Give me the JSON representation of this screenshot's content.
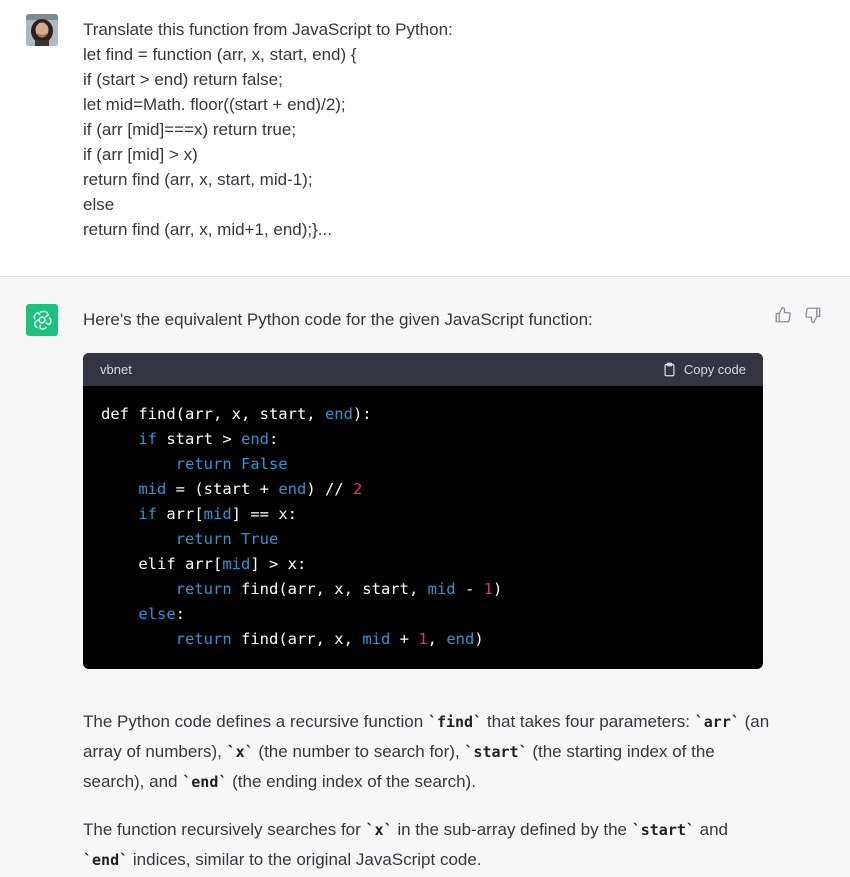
{
  "user": {
    "message_lines": [
      "Translate this function from JavaScript to Python:",
      "let find = function (arr, x, start, end) {",
      "if (start > end) return false;",
      "let mid=Math. floor((start + end)/2);",
      "if (arr [mid]===x) return true;",
      "if (arr [mid] > x)",
      "return find (arr, x, start, mid-1);",
      "else",
      "return find (arr, x, mid+1, end);}..."
    ]
  },
  "assistant": {
    "intro": "Here's the equivalent Python code for the given JavaScript function:",
    "code_block": {
      "language": "vbnet",
      "copy_label": "Copy code",
      "lines": [
        {
          "indent": "",
          "tokens": [
            {
              "t": "def find(arr, x, start, ",
              "c": "plain"
            },
            {
              "t": "end",
              "c": "kw"
            },
            {
              "t": "):",
              "c": "plain"
            }
          ]
        },
        {
          "indent": "    ",
          "tokens": [
            {
              "t": "if",
              "c": "kw"
            },
            {
              "t": " start > ",
              "c": "plain"
            },
            {
              "t": "end",
              "c": "kw"
            },
            {
              "t": ":",
              "c": "plain"
            }
          ]
        },
        {
          "indent": "        ",
          "tokens": [
            {
              "t": "return False",
              "c": "kw"
            }
          ]
        },
        {
          "indent": "    ",
          "tokens": [
            {
              "t": "mid",
              "c": "kw"
            },
            {
              "t": " = (start + ",
              "c": "plain"
            },
            {
              "t": "end",
              "c": "kw"
            },
            {
              "t": ") // ",
              "c": "plain"
            },
            {
              "t": "2",
              "c": "num"
            }
          ]
        },
        {
          "indent": "    ",
          "tokens": [
            {
              "t": "if",
              "c": "kw"
            },
            {
              "t": " arr[",
              "c": "plain"
            },
            {
              "t": "mid",
              "c": "kw"
            },
            {
              "t": "] == x:",
              "c": "plain"
            }
          ]
        },
        {
          "indent": "        ",
          "tokens": [
            {
              "t": "return True",
              "c": "kw"
            }
          ]
        },
        {
          "indent": "    ",
          "tokens": [
            {
              "t": "elif arr[",
              "c": "plain"
            },
            {
              "t": "mid",
              "c": "kw"
            },
            {
              "t": "] > x:",
              "c": "plain"
            }
          ]
        },
        {
          "indent": "        ",
          "tokens": [
            {
              "t": "return",
              "c": "kw"
            },
            {
              "t": " find(arr, x, start, ",
              "c": "plain"
            },
            {
              "t": "mid",
              "c": "kw"
            },
            {
              "t": " - ",
              "c": "plain"
            },
            {
              "t": "1",
              "c": "num"
            },
            {
              "t": ")",
              "c": "plain"
            }
          ]
        },
        {
          "indent": "    ",
          "tokens": [
            {
              "t": "else",
              "c": "kw"
            },
            {
              "t": ":",
              "c": "plain"
            }
          ]
        },
        {
          "indent": "        ",
          "tokens": [
            {
              "t": "return",
              "c": "kw"
            },
            {
              "t": " find(arr, x, ",
              "c": "plain"
            },
            {
              "t": "mid",
              "c": "kw"
            },
            {
              "t": " + ",
              "c": "plain"
            },
            {
              "t": "1",
              "c": "num"
            },
            {
              "t": ", ",
              "c": "plain"
            },
            {
              "t": "end",
              "c": "kw"
            },
            {
              "t": ")",
              "c": "plain"
            }
          ]
        }
      ]
    },
    "paragraph1": [
      {
        "t": "The Python code defines a recursive function ",
        "code": false
      },
      {
        "t": "`find`",
        "code": true
      },
      {
        "t": " that takes four parameters: ",
        "code": false
      },
      {
        "t": "`arr`",
        "code": true
      },
      {
        "t": " (an array of numbers), ",
        "code": false
      },
      {
        "t": "`x`",
        "code": true
      },
      {
        "t": " (the number to search for), ",
        "code": false
      },
      {
        "t": "`start`",
        "code": true
      },
      {
        "t": " (the starting index of the search), and ",
        "code": false
      },
      {
        "t": "`end`",
        "code": true
      },
      {
        "t": " (the ending index of the search).",
        "code": false
      }
    ],
    "paragraph2": [
      {
        "t": "The function recursively searches for ",
        "code": false
      },
      {
        "t": "`x`",
        "code": true
      },
      {
        "t": " in the sub-array defined by the ",
        "code": false
      },
      {
        "t": "`start`",
        "code": true
      },
      {
        "t": " and ",
        "code": false
      },
      {
        "t": "`end`",
        "code": true
      },
      {
        "t": " indices, similar to the original JavaScript code.",
        "code": false
      }
    ]
  },
  "icons": {
    "assistant_avatar": "openai-logo-icon",
    "thumbs_up": "thumbs-up-icon",
    "thumbs_down": "thumbs-down-icon",
    "copy": "clipboard-icon"
  },
  "colors": {
    "assistant_avatar_bg": "#19c37d",
    "code_keyword": "#2e95d3",
    "code_number": "#df3079",
    "code_header_bg": "#343541",
    "bot_row_bg": "#f7f7f8"
  }
}
